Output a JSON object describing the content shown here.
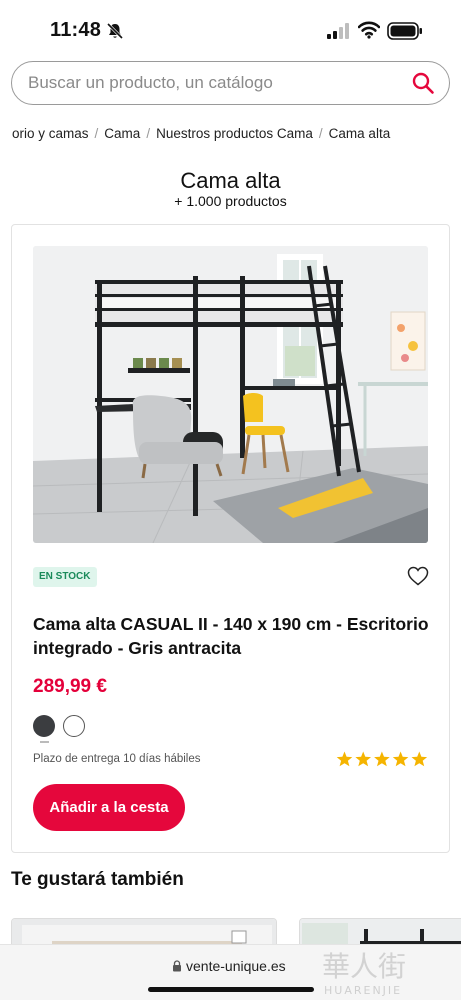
{
  "status_bar": {
    "time": "11:48"
  },
  "search": {
    "placeholder": "Buscar un producto, un catálogo"
  },
  "breadcrumb": {
    "items": [
      "orio y camas",
      "Cama",
      "Nuestros productos Cama",
      "Cama alta"
    ],
    "separator": "/"
  },
  "page": {
    "title": "Cama alta",
    "count": "+ 1.000 productos"
  },
  "product": {
    "stock_label": "EN STOCK",
    "title": "Cama alta CASUAL II - 140 x 190 cm - Escritorio integrado - Gris antracita",
    "price": "289,99 €",
    "swatches": [
      "#3b3d40",
      "#ffffff"
    ],
    "delivery": "Plazo de entrega 10 días hábiles",
    "rating": 5,
    "cta_label": "Añadir a la cesta"
  },
  "recommendations": {
    "title": "Te gustará también"
  },
  "browser": {
    "url": "vente-unique.es"
  },
  "watermark": {
    "text_cn": "華人街",
    "text_en": "HUARENJIE"
  },
  "colors": {
    "accent": "#e5073c",
    "price": "#e4003a",
    "stock_bg": "#dff5ec",
    "stock_text": "#1a8a5a",
    "star": "#f5b400"
  }
}
